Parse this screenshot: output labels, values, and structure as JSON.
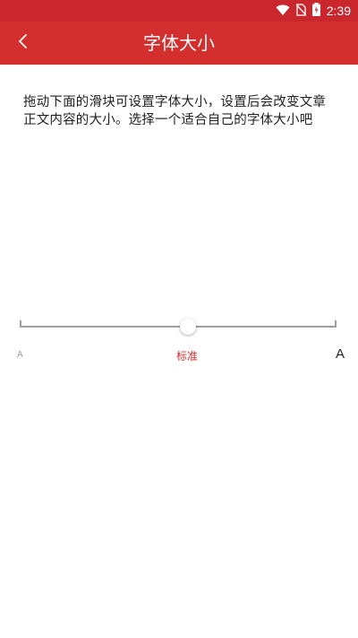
{
  "status_bar": {
    "time": "2:39",
    "icons": [
      "wifi-icon",
      "no-sim-icon",
      "battery-charging-icon"
    ]
  },
  "app_bar": {
    "title": "字体大小",
    "back_icon": "chevron-left-icon"
  },
  "description": "拖动下面的滑块可设置字体大小，设置后会改变文章正文内容的大小。选择一个适合自己的字体大小吧",
  "slider": {
    "value": 0.53,
    "label_small": "A",
    "label_current": "标准",
    "label_large": "A"
  },
  "colors": {
    "primary": "#d32f2f",
    "status_bar": "#c9272d",
    "track": "#9e9e9e",
    "text": "#222222"
  }
}
